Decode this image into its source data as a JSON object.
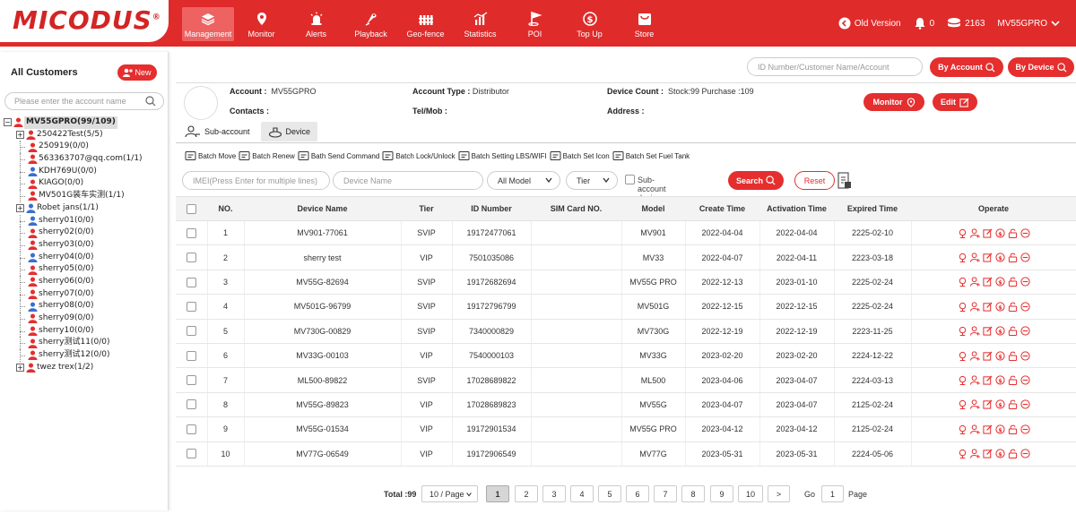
{
  "brand": {
    "logo": "MICODUS",
    "reg": "®"
  },
  "nav": [
    {
      "label": "Management",
      "icon": "layers-icon",
      "active": true
    },
    {
      "label": "Monitor",
      "icon": "location-pin-icon"
    },
    {
      "label": "Alerts",
      "icon": "alarm-icon"
    },
    {
      "label": "Playback",
      "icon": "playback-icon"
    },
    {
      "label": "Geo-fence",
      "icon": "geofence-icon"
    },
    {
      "label": "Statistics",
      "icon": "statistics-icon"
    },
    {
      "label": "POI",
      "icon": "poi-icon"
    },
    {
      "label": "Top Up",
      "icon": "topup-icon"
    },
    {
      "label": "Store",
      "icon": "store-icon"
    }
  ],
  "topright": {
    "old_version": "Old Version",
    "notifications": "0",
    "points": "2163",
    "user": "MV55GPRO"
  },
  "left": {
    "title": "All Customers",
    "new_label": "New",
    "search_placeholder": "Please enter the account name",
    "tree": [
      {
        "label": "MV55GPRO(99/109)",
        "type": "root",
        "color": "#e52e2e"
      },
      {
        "label": "250422Test(5/5)",
        "type": "expand",
        "color": "#e52e2e"
      },
      {
        "label": "250919(0/0)",
        "type": "leaf",
        "color": "#e52e2e"
      },
      {
        "label": "563363707@qq.com(1/1)",
        "type": "leaf",
        "color": "#e52e2e"
      },
      {
        "label": "KDH769U(0/0)",
        "type": "leaf",
        "color": "#3a6fd0"
      },
      {
        "label": "KIAGO(0/0)",
        "type": "leaf",
        "color": "#e52e2e"
      },
      {
        "label": "MV501G装车实测(1/1)",
        "type": "leaf",
        "color": "#e52e2e"
      },
      {
        "label": "Robet jans(1/1)",
        "type": "expand",
        "color": "#3a6fd0"
      },
      {
        "label": "sherry01(0/0)",
        "type": "leaf",
        "color": "#3a6fd0"
      },
      {
        "label": "sherry02(0/0)",
        "type": "leaf",
        "color": "#e52e2e"
      },
      {
        "label": "sherry03(0/0)",
        "type": "leaf",
        "color": "#e52e2e"
      },
      {
        "label": "sherry04(0/0)",
        "type": "leaf",
        "color": "#3a6fd0"
      },
      {
        "label": "sherry05(0/0)",
        "type": "leaf",
        "color": "#e52e2e"
      },
      {
        "label": "sherry06(0/0)",
        "type": "leaf",
        "color": "#e52e2e"
      },
      {
        "label": "sherry07(0/0)",
        "type": "leaf",
        "color": "#e52e2e"
      },
      {
        "label": "sherry08(0/0)",
        "type": "leaf",
        "color": "#3a6fd0"
      },
      {
        "label": "sherry09(0/0)",
        "type": "leaf",
        "color": "#e52e2e"
      },
      {
        "label": "sherry10(0/0)",
        "type": "leaf",
        "color": "#e52e2e"
      },
      {
        "label": "sherry测试11(0/0)",
        "type": "leaf",
        "color": "#e52e2e"
      },
      {
        "label": "sherry测试12(0/0)",
        "type": "leaf",
        "color": "#e52e2e"
      },
      {
        "label": "twez trex(1/2)",
        "type": "expand",
        "color": "#e52e2e"
      }
    ]
  },
  "search": {
    "placeholder": "ID Number/Customer Name/Account",
    "by_account": "By Account",
    "by_device": "By Device"
  },
  "account": {
    "account_label": "Account :",
    "account_value": "MV55GPRO",
    "type_label": "Account Type :",
    "type_value": "Distributor",
    "count_label": "Device Count :",
    "count_value": "Stock:99  Purchase :109",
    "contacts_label": "Contacts :",
    "telmob_label": "Tel/Mob :",
    "address_label": "Address :",
    "monitor_btn": "Monitor",
    "edit_btn": "Edit"
  },
  "tabs": {
    "subaccount": "Sub-account",
    "device": "Device"
  },
  "batch": [
    "Batch Move",
    "Batch Renew",
    "Bath Send Command",
    "Batch Lock/Unlock",
    "Batch Setting LBS/WIFI",
    "Batch Set Icon",
    "Batch Set Fuel Tank"
  ],
  "filters": {
    "imei_placeholder": "IMEI(Press Enter for multiple lines)",
    "name_placeholder": "Device Name",
    "model": "All Model",
    "tier": "Tier",
    "subaccount_devices": "Sub-account devices",
    "search": "Search",
    "reset": "Reset"
  },
  "table": {
    "headers": [
      "NO.",
      "Device Name",
      "Tier",
      "ID Number",
      "SIM Card NO.",
      "Model",
      "Create Time",
      "Activation Time",
      "Expired Time",
      "Operate"
    ],
    "rows": [
      [
        "1",
        "MV901-77061",
        "SVIP",
        "19172477061",
        "",
        "MV901",
        "2022-04-04",
        "2022-04-04",
        "2225-02-10"
      ],
      [
        "2",
        "sherry test",
        "VIP",
        "7501035086",
        "",
        "MV33",
        "2022-04-07",
        "2022-04-11",
        "2223-03-18"
      ],
      [
        "3",
        "MV55G-82694",
        "SVIP",
        "19172682694",
        "",
        "MV55G PRO",
        "2022-12-13",
        "2023-01-10",
        "2225-02-24"
      ],
      [
        "4",
        "MV501G-96799",
        "SVIP",
        "19172796799",
        "",
        "MV501G",
        "2022-12-15",
        "2022-12-15",
        "2225-02-24"
      ],
      [
        "5",
        "MV730G-00829",
        "SVIP",
        "7340000829",
        "",
        "MV730G",
        "2022-12-19",
        "2022-12-19",
        "2223-11-25"
      ],
      [
        "6",
        "MV33G-00103",
        "VIP",
        "7540000103",
        "",
        "MV33G",
        "2023-02-20",
        "2023-02-20",
        "2224-12-22"
      ],
      [
        "7",
        "ML500-89822",
        "SVIP",
        "17028689822",
        "",
        "ML500",
        "2023-04-06",
        "2023-04-07",
        "2224-03-13"
      ],
      [
        "8",
        "MV55G-89823",
        "VIP",
        "17028689823",
        "",
        "MV55G",
        "2023-04-07",
        "2023-04-07",
        "2125-02-24"
      ],
      [
        "9",
        "MV55G-01534",
        "VIP",
        "19172901534",
        "",
        "MV55G PRO",
        "2023-04-12",
        "2023-04-12",
        "2125-02-24"
      ],
      [
        "10",
        "MV77G-06549",
        "VIP",
        "19172906549",
        "",
        "MV77G",
        "2023-05-31",
        "2023-05-31",
        "2224-05-06"
      ]
    ]
  },
  "pagination": {
    "total": "Total :99",
    "per_page": "10 / Page",
    "pages": [
      "1",
      "2",
      "3",
      "4",
      "5",
      "6",
      "7",
      "8",
      "9",
      "10"
    ],
    "next": ">",
    "go": "Go",
    "go_value": "1",
    "page": "Page",
    "current": "1"
  },
  "colors": {
    "brand_red": "#e02b2b",
    "accent": "#e52e2e"
  }
}
